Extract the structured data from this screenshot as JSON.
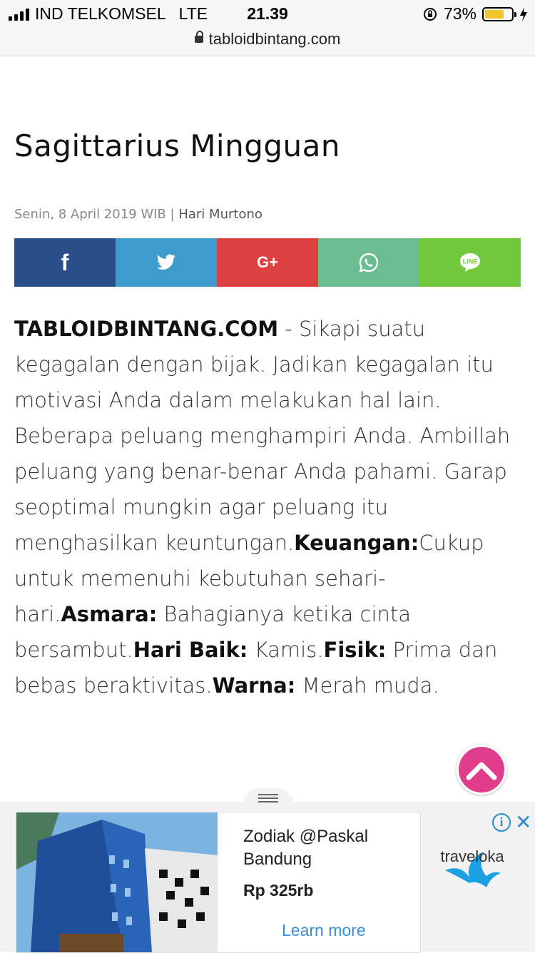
{
  "status_bar": {
    "carrier": "IND TELKOMSEL",
    "network": "LTE",
    "time": "21.39",
    "battery": "73%",
    "battery_level": 0.73
  },
  "browser": {
    "url": "tabloidbintang.com"
  },
  "article": {
    "title": "Sagittarius Mingguan",
    "date": "Senin, 8 April 2019 WIB",
    "separator": "|",
    "author": "Hari Murtono",
    "source": "TABLOIDBINTANG.COM",
    "intro": " - Sikapi suatu kegagalan dengan bijak. Jadikan kegagalan itu motivasi Anda dalam melakukan hal lain. Beberapa peluang menghampiri Anda. Ambillah peluang yang benar-benar Anda pahami. Garap seoptimal mungkin agar peluang itu menghasilkan keuntungan.",
    "finance_label": "Keuangan:",
    "finance_text": "Cukup untuk memenuhi kebutuhan sehari-hari.",
    "love_label": "Asmara:",
    "love_text": " Bahagianya ketika cinta bersambut.",
    "day_label": "Hari Baik:",
    "day_text": " Kamis.",
    "physical_label": "Fisik:",
    "physical_text": " Prima dan bebas beraktivitas.",
    "color_label": "Warna:",
    "color_text": " Merah muda."
  },
  "share": {
    "facebook_glyph": "f",
    "googleplus_glyph": "G+",
    "line_glyph": "LINE",
    "colors": {
      "facebook": "#2b4f8a",
      "twitter": "#3d9bcd",
      "googleplus": "#dd4040",
      "whatsapp": "#6bbc91",
      "line": "#72c83c"
    }
  },
  "ad": {
    "name": "Zodiak @Paskal Bandung",
    "price": "Rp 325rb",
    "cta": "Learn more",
    "brand": "traveloka",
    "info_glyph": "i",
    "close_glyph": "✕"
  },
  "scroll_top_color": "#e03d8c"
}
